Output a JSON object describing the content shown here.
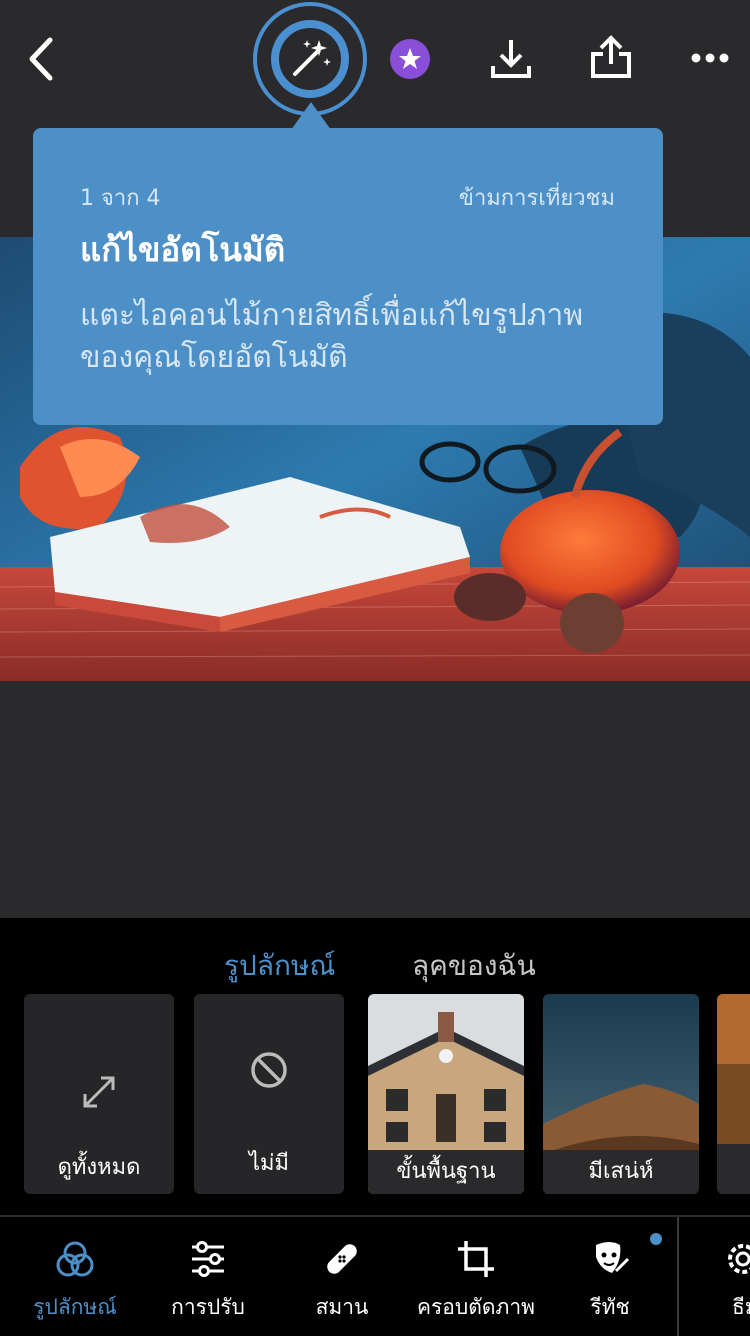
{
  "header": {
    "back": "back-icon",
    "auto": "magic-wand-icon",
    "premium": "star-icon",
    "download": "download-icon",
    "share": "share-icon",
    "more": "more-icon"
  },
  "tooltip": {
    "step": "1 จาก 4",
    "skip": "ข้ามการเที่ยวชม",
    "title": "แก้ไขอัตโนมัติ",
    "body": "แตะไอคอนไม้กายสิทธิ์เพื่อแก้ไขรูปภาพของคุณโดยอัตโนมัติ"
  },
  "presets": {
    "tabs": [
      "รูปลักษณ์",
      "ลุคของฉัน"
    ],
    "tiles": [
      "ดูทั้งหมด",
      "ไม่มี",
      "ขั้นพื้นฐาน",
      "มีเสน่ห์"
    ]
  },
  "toolbar": {
    "items": [
      "รูปลักษณ์",
      "การปรับ",
      "สมาน",
      "ครอบตัดภาพ",
      "รีทัช",
      "ธีม"
    ]
  },
  "colors": {
    "accent": "#4d90c8",
    "premium": "#8a4fd8",
    "background": "#2a2a2c"
  }
}
